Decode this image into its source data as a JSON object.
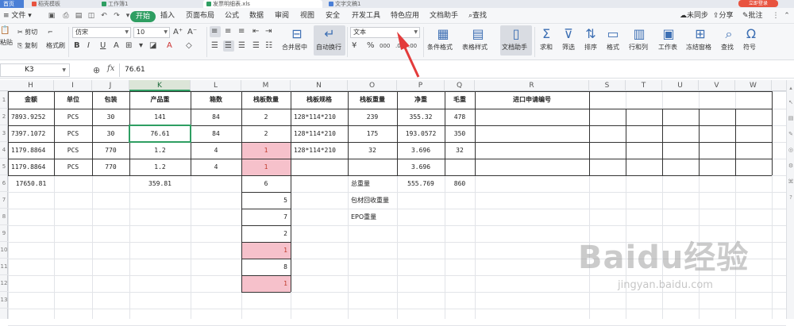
{
  "tabs": {
    "home": "首页",
    "t1": "稻壳模板",
    "t2": "工作簿1",
    "t3": "发票明细表.xls",
    "t4": "文字文稿1",
    "login": "立即登录"
  },
  "menu": {
    "file": "文件",
    "start": "开始",
    "insert": "插入",
    "layout": "页面布局",
    "formula": "公式",
    "data": "数据",
    "review": "审阅",
    "view": "视图",
    "security": "安全",
    "dev": "开发工具",
    "special": "特色应用",
    "doc_assist": "文档助手",
    "search": "查找",
    "sync": "未同步",
    "share": "分享",
    "comment": "批注"
  },
  "ribbon": {
    "paste": "粘贴",
    "cut": "剪切",
    "copy": "复制",
    "format_painter": "格式刷",
    "font_name": "仿宋",
    "font_size": "10",
    "merge_center": "合并居中",
    "auto_wrap": "自动换行",
    "number_format": "文本",
    "conditional_format": "条件格式",
    "table_style": "表格样式",
    "doc_helper": "文档助手",
    "sum": "求和",
    "filter": "筛选",
    "sort": "排序",
    "format": "格式",
    "row_col": "行和列",
    "worksheet": "工作表",
    "freeze": "冻结窗格",
    "find": "查找",
    "symbol": "符号"
  },
  "formula_bar": {
    "cell_ref": "K3",
    "fx": "fx",
    "value": "76.61"
  },
  "columns": [
    "H",
    "I",
    "J",
    "K",
    "L",
    "M",
    "N",
    "O",
    "P",
    "Q",
    "R",
    "S",
    "T",
    "U",
    "V",
    "W"
  ],
  "rows": [
    "1",
    "2",
    "3",
    "4",
    "5",
    "6",
    "7",
    "8",
    "9",
    "10",
    "11",
    "12",
    "13"
  ],
  "sheet": {
    "headers": {
      "H": "金额",
      "I": "单位",
      "J": "包装",
      "K": "产品重",
      "L": "箱数",
      "M": "栈板数量",
      "N": "栈板规格",
      "O": "栈板重量",
      "P": "净重",
      "Q": "毛重",
      "R": "进口申请编号"
    },
    "row2": {
      "H": "7893.9252",
      "I": "PCS",
      "J": "30",
      "K": "141",
      "L": "84",
      "M": "2",
      "N": "128*114*210",
      "O": "239",
      "P": "355.32",
      "Q": "478"
    },
    "row3": {
      "H": "7397.1072",
      "I": "PCS",
      "J": "30",
      "K": "76.61",
      "L": "84",
      "M": "2",
      "N": "128*114*210",
      "O": "175",
      "P": "193.0572",
      "Q": "350"
    },
    "row4": {
      "H": "1179.8864",
      "I": "PCS",
      "J": "770",
      "K": "1.2",
      "L": "4",
      "M": "1",
      "N": "128*114*210",
      "O": "32",
      "P": "3.696",
      "Q": "32"
    },
    "row5": {
      "H": "1179.8864",
      "I": "PCS",
      "J": "770",
      "K": "1.2",
      "L": "4",
      "M": "1",
      "P": "3.696"
    },
    "row6": {
      "H": "17650.81",
      "K": "359.81",
      "M": "6",
      "O": "总重量",
      "P": "555.769",
      "Q": "860"
    },
    "row7": {
      "M": "5",
      "O": "包材回收重量"
    },
    "row8": {
      "M": "7",
      "O": "EPO重量"
    },
    "row9": {
      "M": "2"
    },
    "row10": {
      "M": "1"
    },
    "row11": {
      "M": "8"
    },
    "row12": {
      "M": "1"
    }
  },
  "watermark": {
    "logo": "Baidu经验",
    "url": "jingyan.baidu.com"
  },
  "colors": {
    "accent": "#2e9e62",
    "highlight": "#f6c1cb",
    "arrow": "#e33b3b"
  }
}
